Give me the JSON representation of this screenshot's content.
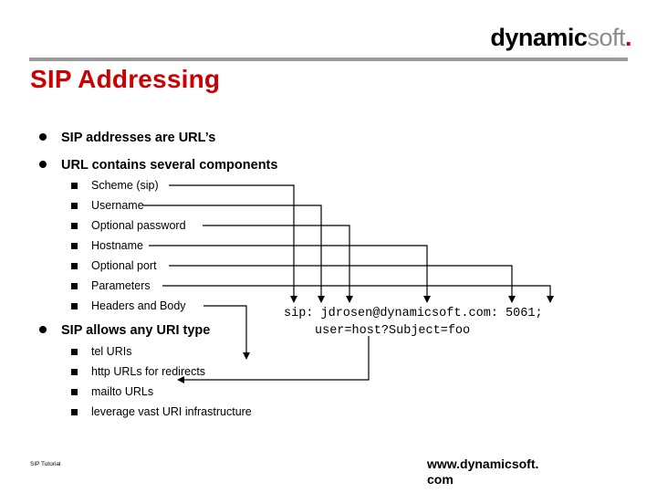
{
  "logo": {
    "main": "dynamic",
    "soft": "soft",
    "dot": "."
  },
  "title": "SIP Addressing",
  "bullets_level1": [
    {
      "label": "SIP addresses are URL’s"
    },
    {
      "label": "URL contains several components"
    },
    {
      "label": "SIP allows any URI type"
    }
  ],
  "components": [
    {
      "label": "Scheme (sip)"
    },
    {
      "label": "Username"
    },
    {
      "label": "Optional password"
    },
    {
      "label": "Hostname"
    },
    {
      "label": "Optional port"
    },
    {
      "label": "Parameters"
    },
    {
      "label": "Headers and Body"
    }
  ],
  "uri_types": [
    {
      "label": "tel URIs"
    },
    {
      "label": "http URLs for redirects"
    },
    {
      "label": "mailto URLs"
    },
    {
      "label": "leverage vast URI infrastructure"
    }
  ],
  "example": {
    "line1": "sip: jdrosen@dynamicsoft.com: 5061;",
    "line2": "user=host?Subject=foo"
  },
  "footer": {
    "left": "SIP Tutorial",
    "right_line1": "www.dynamicsoft.",
    "right_line2": "com"
  },
  "colors": {
    "title_red": "#cc0000",
    "rule_gray": "#9a9a9a",
    "logo_gray": "#8c8c8c"
  }
}
